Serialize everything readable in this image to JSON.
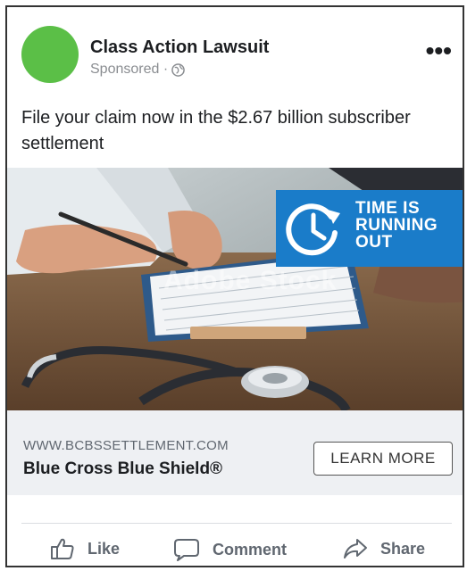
{
  "post": {
    "page_name": "Class Action Lawsuit",
    "sponsored": "Sponsored ·",
    "more_label": "•••",
    "text": "File your claim now in the $2.67 billion subscriber settlement"
  },
  "image": {
    "banner_lines": [
      "TIME IS",
      "RUNNING",
      "OUT"
    ],
    "watermark": "Adobe Stock"
  },
  "link": {
    "domain": "WWW.BCBSSETTLEMENT.COM",
    "title": "Blue Cross Blue Shield®",
    "cta": "LEARN MORE"
  },
  "actions": {
    "like": "Like",
    "comment": "Comment",
    "share": "Share"
  },
  "colors": {
    "avatar": "#5bbf47",
    "banner": "#1a7cc9"
  },
  "icons": [
    "globe-icon",
    "clock-icon",
    "like-icon",
    "comment-icon",
    "share-icon",
    "more-options-icon"
  ]
}
